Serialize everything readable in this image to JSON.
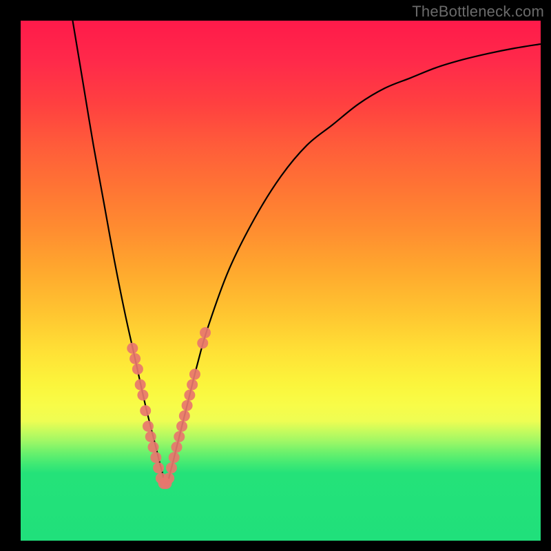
{
  "watermark": "TheBottleneck.com",
  "chart_data": {
    "type": "line",
    "title": "",
    "xlabel": "",
    "ylabel": "",
    "xlim": [
      0,
      100
    ],
    "ylim": [
      0,
      100
    ],
    "series": [
      {
        "name": "bottleneck-curve",
        "x": [
          10,
          12,
          14,
          16,
          18,
          20,
          22,
          24,
          26,
          27,
          28,
          29,
          30,
          32,
          34,
          36,
          40,
          45,
          50,
          55,
          60,
          65,
          70,
          75,
          80,
          85,
          90,
          95,
          100
        ],
        "y": [
          100,
          88,
          76,
          65,
          54,
          44,
          35,
          26,
          18,
          14,
          11,
          14,
          18,
          26,
          34,
          41,
          52,
          62,
          70,
          76,
          80,
          84,
          87,
          89,
          91,
          92.5,
          93.7,
          94.7,
          95.5
        ]
      }
    ],
    "markers": {
      "name": "bottleneck-markers",
      "color": "#e8766e",
      "points": [
        {
          "x": 21.5,
          "y": 37
        },
        {
          "x": 22.0,
          "y": 35
        },
        {
          "x": 22.5,
          "y": 33
        },
        {
          "x": 23.0,
          "y": 30
        },
        {
          "x": 23.5,
          "y": 28
        },
        {
          "x": 24.0,
          "y": 25
        },
        {
          "x": 24.5,
          "y": 22
        },
        {
          "x": 25.0,
          "y": 20
        },
        {
          "x": 25.5,
          "y": 18
        },
        {
          "x": 26.0,
          "y": 16
        },
        {
          "x": 26.5,
          "y": 14
        },
        {
          "x": 27.0,
          "y": 12
        },
        {
          "x": 27.5,
          "y": 11
        },
        {
          "x": 28.0,
          "y": 11
        },
        {
          "x": 28.5,
          "y": 12
        },
        {
          "x": 29.0,
          "y": 14
        },
        {
          "x": 29.5,
          "y": 16
        },
        {
          "x": 30.0,
          "y": 18
        },
        {
          "x": 30.5,
          "y": 20
        },
        {
          "x": 31.0,
          "y": 22
        },
        {
          "x": 31.5,
          "y": 24
        },
        {
          "x": 32.0,
          "y": 26
        },
        {
          "x": 32.5,
          "y": 28
        },
        {
          "x": 33.0,
          "y": 30
        },
        {
          "x": 33.5,
          "y": 32
        },
        {
          "x": 35.0,
          "y": 38
        },
        {
          "x": 35.5,
          "y": 40
        }
      ]
    },
    "gradient_stops": [
      {
        "pos": 0,
        "color": "#ff1a4a"
      },
      {
        "pos": 50,
        "color": "#ffd030"
      },
      {
        "pos": 78,
        "color": "#f8fc48"
      },
      {
        "pos": 100,
        "color": "#20e07b"
      }
    ]
  }
}
